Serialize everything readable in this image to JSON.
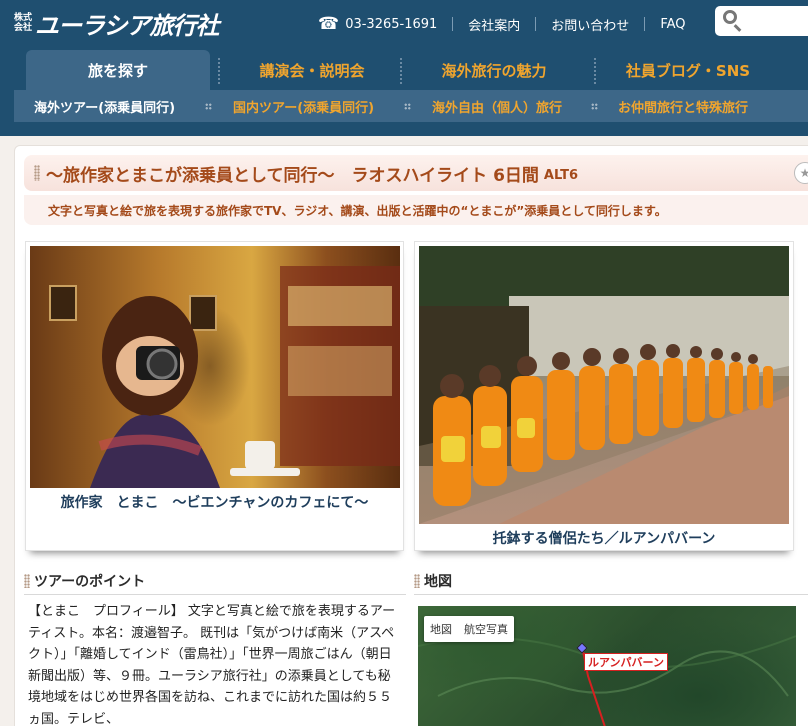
{
  "header": {
    "logo_top": "株式",
    "logo_bottom": "会社",
    "logo_name": "ユーラシア旅行社",
    "phone": "03-3265-1691",
    "links": [
      "会社案内",
      "お問い合わせ",
      "FAQ"
    ],
    "search_placeholder": ""
  },
  "main_nav": [
    "旅を探す",
    "講演会・説明会",
    "海外旅行の魅力",
    "社員ブログ・SNS"
  ],
  "sub_nav": [
    "海外ツアー(添乗員同行)",
    "国内ツアー(添乗員同行)",
    "海外自由（個人）旅行",
    "お仲間旅行と特殊旅行"
  ],
  "tour": {
    "title": "〜旅作家とまこが添乗員として同行〜　ラオスハイライト 6日間",
    "code": "ALT6",
    "subtitle": "文字と写真と絵で旅を表現する旅作家でTV、ラジオ、講演、出版と活躍中の“とまこが”添乗員として同行します。"
  },
  "photos": [
    {
      "caption": "旅作家　とまこ　〜ビエンチャンのカフェにて〜"
    },
    {
      "caption": "托鉢する僧侶たち／ルアンパバーン"
    }
  ],
  "sections": {
    "points_title": "ツアーのポイント",
    "map_title": "地図"
  },
  "points_text": "【とまこ　プロフィール】 文字と写真と絵で旅を表現するアーティスト。本名：渡邉智子。 既刊は「気がつけば南米（アスペクト）」「離婚してインド（雷鳥社）」「世界一周旅ごはん（朝日新聞出版）等、９冊。ユーラシア旅行社」の添乗員としても秘境地域をはじめ世界各国を訪ね、これまでに訪れた国は約５５ヵ国。テレビ、",
  "map": {
    "toggle_map": "地図",
    "toggle_satellite": "航空写真",
    "marker_label": "ルアンパバーン"
  },
  "colors": {
    "header_bg": "#1f4f70",
    "nav_accent": "#f0a52e",
    "title_text": "#a44a1a",
    "caption_text": "#1f3e5c"
  }
}
